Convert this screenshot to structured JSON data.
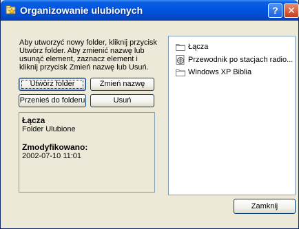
{
  "window": {
    "title": "Organizowanie ulubionych",
    "help_label": "?",
    "close_label": "✕"
  },
  "description": "Aby utworzyć nowy folder, kliknij przycisk Utwórz folder. Aby zmienić nazwę lub usunąć element, zaznacz element i kliknij przycisk Zmień nazwę lub Usuń.",
  "buttons": {
    "create_folder": "Utwórz folder",
    "rename": "Zmień nazwę",
    "move_to_folder": "Przenieś do folderu",
    "delete": "Usuń",
    "close": "Zamknij"
  },
  "info": {
    "name": "Łącza",
    "type": "Folder Ulubione",
    "modified_label": "Zmodyfikowano:",
    "modified_value": "2002-07-10 11:01"
  },
  "favorites": [
    {
      "label": "Łącza",
      "icon": "folder-icon"
    },
    {
      "label": "Przewodnik po stacjach radio...",
      "icon": "internet-shortcut-icon"
    },
    {
      "label": "Windows XP Biblia",
      "icon": "folder-icon"
    }
  ],
  "colors": {
    "titlebar": "#0054e3",
    "dialog_background": "#ece9d8",
    "panel_border": "#7f9db9"
  }
}
